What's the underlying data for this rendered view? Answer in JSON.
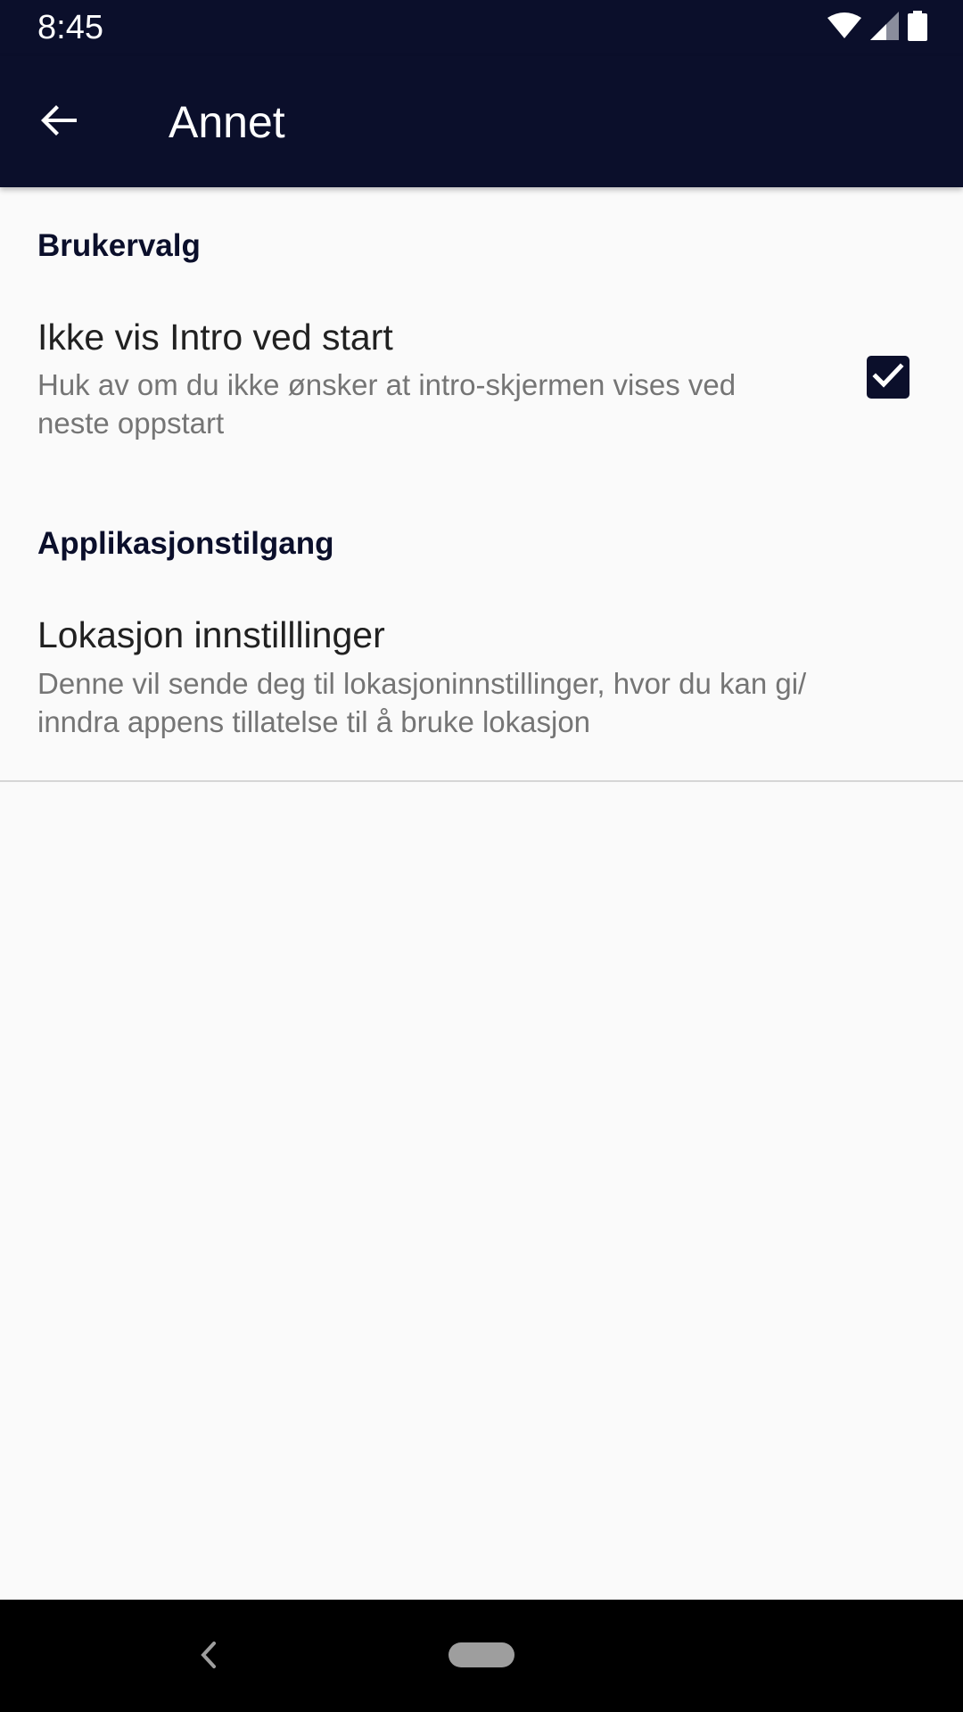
{
  "status_bar": {
    "time": "8:45",
    "icons": [
      "wifi-icon",
      "cellular-signal-icon",
      "battery-icon"
    ]
  },
  "app_bar": {
    "title": "Annet",
    "back_icon": "arrow-back-icon"
  },
  "sections": {
    "user_prefs": {
      "header": "Brukervalg",
      "intro_pref": {
        "title": "Ikke vis Intro ved start",
        "summary_line1": "Huk av om du ikke ønsker at intro-skjermen vises ved",
        "summary_line2": "neste oppstart",
        "checked": true
      }
    },
    "app_access": {
      "header": "Applikasjonstilgang",
      "location_pref": {
        "title": "Lokasjon innstilllinger",
        "summary_line1": "Denne vil sende deg til lokasjoninnstillinger, hvor du kan gi/",
        "summary_line2": "inndra appens tillatelse til å bruke lokasjon"
      }
    }
  },
  "colors": {
    "primary_dark": "#0b0f2b",
    "background": "#fafafa",
    "title_text": "#212121",
    "summary_text": "#757575"
  }
}
